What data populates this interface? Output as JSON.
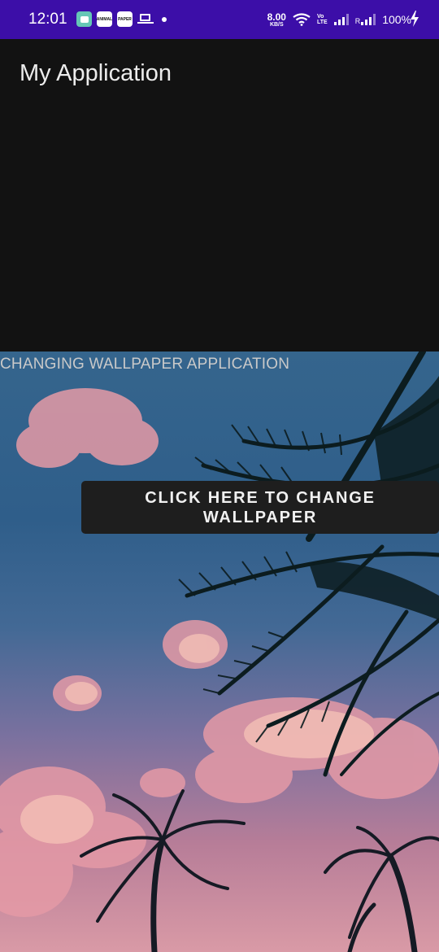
{
  "status_bar": {
    "time": "12:01",
    "notification_icons": [
      "app-icon",
      "news-icon",
      "news-icon",
      "laptop-icon",
      "dot-icon"
    ],
    "notif_news1": "ANIMAL",
    "notif_news2": "PAPER",
    "net_speed_value": "8.00",
    "net_speed_unit": "KB/S",
    "volte_top": "Vo",
    "volte_bottom": "LTE",
    "roaming": "R",
    "battery": "100%",
    "colors": {
      "background": "#3c0ea8"
    }
  },
  "app_bar": {
    "title": "My Application"
  },
  "content": {
    "label": "CHANGING WALLPAPER APPLICATION",
    "button_label": "CLICK HERE TO CHANGE\nWALLPAPER"
  },
  "colors": {
    "background": "#121212",
    "button": "#1e1e1e",
    "sky_top": "#35658d",
    "sky_bottom": "#d99aa6"
  }
}
